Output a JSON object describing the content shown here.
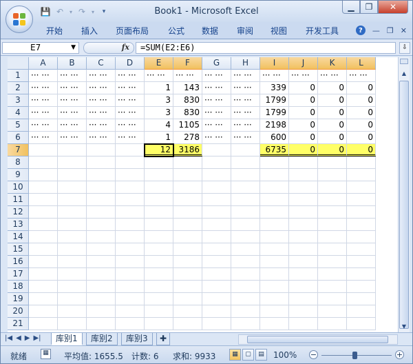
{
  "window": {
    "title": "Book1 - Microsoft Excel"
  },
  "qat": {
    "save_icon": "save-icon",
    "undo_icon": "undo-icon",
    "redo_icon": "redo-icon",
    "customize_icon": "chevron-down-icon"
  },
  "ribbon": {
    "tabs": [
      "开始",
      "插入",
      "页面布局",
      "公式",
      "数据",
      "审阅",
      "视图",
      "开发工具"
    ],
    "help": "?"
  },
  "formula_bar": {
    "name_box": "E7",
    "fx": "fx",
    "formula": "=SUM(E2:E6)"
  },
  "columns": [
    "A",
    "B",
    "C",
    "D",
    "E",
    "F",
    "G",
    "H",
    "I",
    "J",
    "K",
    "L"
  ],
  "selected_columns": [
    "E",
    "F",
    "I",
    "J",
    "K",
    "L"
  ],
  "rows": [
    "1",
    "2",
    "3",
    "4",
    "5",
    "6",
    "7",
    "8",
    "9",
    "10",
    "11",
    "12",
    "13",
    "14",
    "15",
    "16",
    "17",
    "18",
    "19",
    "20",
    "21"
  ],
  "cells": {
    "hidden_text": "··· ···",
    "E": [
      "",
      "1",
      "3",
      "3",
      "4",
      "1",
      "12"
    ],
    "F": [
      "",
      "143",
      "830",
      "830",
      "1105",
      "278",
      "3186"
    ],
    "I": [
      "",
      "339",
      "1799",
      "1799",
      "2198",
      "600",
      "6735"
    ],
    "J": [
      "",
      "0",
      "0",
      "0",
      "0",
      "0",
      "0"
    ],
    "K": [
      "",
      "0",
      "0",
      "0",
      "0",
      "0",
      "0"
    ],
    "L": [
      "",
      "0",
      "0",
      "0",
      "0",
      "0",
      "0"
    ]
  },
  "sheets": [
    "库别1",
    "库别2",
    "库别3"
  ],
  "active_sheet": "库别1",
  "status": {
    "ready": "就绪",
    "average": "平均值: 1655.5",
    "count": "计数: 6",
    "sum": "求和: 9933",
    "zoom": "100%"
  },
  "colors": {
    "highlight": "#ffff66",
    "selection_header": "#f1c15f"
  }
}
